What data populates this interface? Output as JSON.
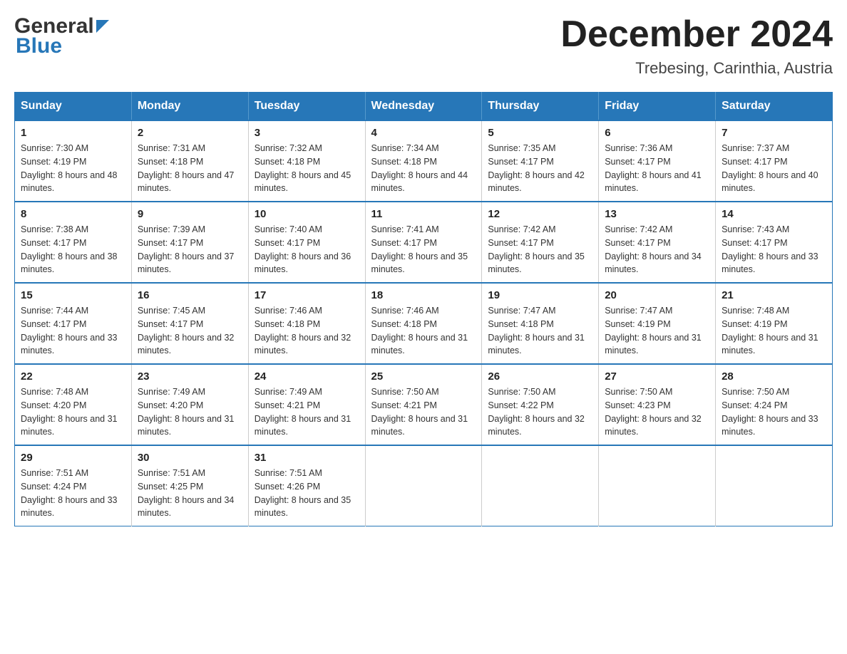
{
  "header": {
    "logo_general": "General",
    "logo_blue": "Blue",
    "month_title": "December 2024",
    "location": "Trebesing, Carinthia, Austria"
  },
  "weekdays": [
    "Sunday",
    "Monday",
    "Tuesday",
    "Wednesday",
    "Thursday",
    "Friday",
    "Saturday"
  ],
  "weeks": [
    [
      {
        "day": "1",
        "sunrise": "7:30 AM",
        "sunset": "4:19 PM",
        "daylight": "8 hours and 48 minutes."
      },
      {
        "day": "2",
        "sunrise": "7:31 AM",
        "sunset": "4:18 PM",
        "daylight": "8 hours and 47 minutes."
      },
      {
        "day": "3",
        "sunrise": "7:32 AM",
        "sunset": "4:18 PM",
        "daylight": "8 hours and 45 minutes."
      },
      {
        "day": "4",
        "sunrise": "7:34 AM",
        "sunset": "4:18 PM",
        "daylight": "8 hours and 44 minutes."
      },
      {
        "day": "5",
        "sunrise": "7:35 AM",
        "sunset": "4:17 PM",
        "daylight": "8 hours and 42 minutes."
      },
      {
        "day": "6",
        "sunrise": "7:36 AM",
        "sunset": "4:17 PM",
        "daylight": "8 hours and 41 minutes."
      },
      {
        "day": "7",
        "sunrise": "7:37 AM",
        "sunset": "4:17 PM",
        "daylight": "8 hours and 40 minutes."
      }
    ],
    [
      {
        "day": "8",
        "sunrise": "7:38 AM",
        "sunset": "4:17 PM",
        "daylight": "8 hours and 38 minutes."
      },
      {
        "day": "9",
        "sunrise": "7:39 AM",
        "sunset": "4:17 PM",
        "daylight": "8 hours and 37 minutes."
      },
      {
        "day": "10",
        "sunrise": "7:40 AM",
        "sunset": "4:17 PM",
        "daylight": "8 hours and 36 minutes."
      },
      {
        "day": "11",
        "sunrise": "7:41 AM",
        "sunset": "4:17 PM",
        "daylight": "8 hours and 35 minutes."
      },
      {
        "day": "12",
        "sunrise": "7:42 AM",
        "sunset": "4:17 PM",
        "daylight": "8 hours and 35 minutes."
      },
      {
        "day": "13",
        "sunrise": "7:42 AM",
        "sunset": "4:17 PM",
        "daylight": "8 hours and 34 minutes."
      },
      {
        "day": "14",
        "sunrise": "7:43 AM",
        "sunset": "4:17 PM",
        "daylight": "8 hours and 33 minutes."
      }
    ],
    [
      {
        "day": "15",
        "sunrise": "7:44 AM",
        "sunset": "4:17 PM",
        "daylight": "8 hours and 33 minutes."
      },
      {
        "day": "16",
        "sunrise": "7:45 AM",
        "sunset": "4:17 PM",
        "daylight": "8 hours and 32 minutes."
      },
      {
        "day": "17",
        "sunrise": "7:46 AM",
        "sunset": "4:18 PM",
        "daylight": "8 hours and 32 minutes."
      },
      {
        "day": "18",
        "sunrise": "7:46 AM",
        "sunset": "4:18 PM",
        "daylight": "8 hours and 31 minutes."
      },
      {
        "day": "19",
        "sunrise": "7:47 AM",
        "sunset": "4:18 PM",
        "daylight": "8 hours and 31 minutes."
      },
      {
        "day": "20",
        "sunrise": "7:47 AM",
        "sunset": "4:19 PM",
        "daylight": "8 hours and 31 minutes."
      },
      {
        "day": "21",
        "sunrise": "7:48 AM",
        "sunset": "4:19 PM",
        "daylight": "8 hours and 31 minutes."
      }
    ],
    [
      {
        "day": "22",
        "sunrise": "7:48 AM",
        "sunset": "4:20 PM",
        "daylight": "8 hours and 31 minutes."
      },
      {
        "day": "23",
        "sunrise": "7:49 AM",
        "sunset": "4:20 PM",
        "daylight": "8 hours and 31 minutes."
      },
      {
        "day": "24",
        "sunrise": "7:49 AM",
        "sunset": "4:21 PM",
        "daylight": "8 hours and 31 minutes."
      },
      {
        "day": "25",
        "sunrise": "7:50 AM",
        "sunset": "4:21 PM",
        "daylight": "8 hours and 31 minutes."
      },
      {
        "day": "26",
        "sunrise": "7:50 AM",
        "sunset": "4:22 PM",
        "daylight": "8 hours and 32 minutes."
      },
      {
        "day": "27",
        "sunrise": "7:50 AM",
        "sunset": "4:23 PM",
        "daylight": "8 hours and 32 minutes."
      },
      {
        "day": "28",
        "sunrise": "7:50 AM",
        "sunset": "4:24 PM",
        "daylight": "8 hours and 33 minutes."
      }
    ],
    [
      {
        "day": "29",
        "sunrise": "7:51 AM",
        "sunset": "4:24 PM",
        "daylight": "8 hours and 33 minutes."
      },
      {
        "day": "30",
        "sunrise": "7:51 AM",
        "sunset": "4:25 PM",
        "daylight": "8 hours and 34 minutes."
      },
      {
        "day": "31",
        "sunrise": "7:51 AM",
        "sunset": "4:26 PM",
        "daylight": "8 hours and 35 minutes."
      },
      null,
      null,
      null,
      null
    ]
  ]
}
